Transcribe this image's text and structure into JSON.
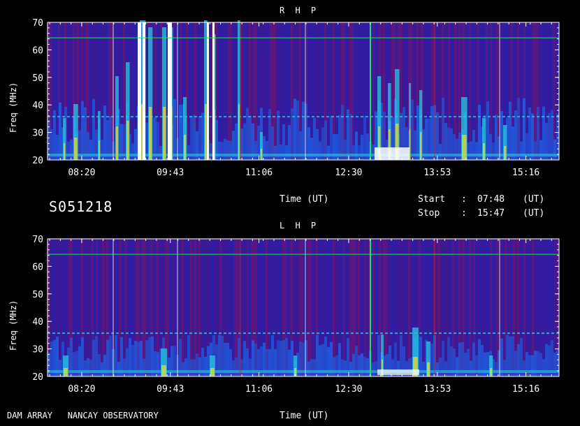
{
  "chart_data": [
    {
      "type": "heatmap",
      "title": "R H P",
      "ylabel": "Freq (MHz)",
      "xlabel": "Time (UT)",
      "ylim": [
        20,
        70
      ],
      "yticks": [
        "20",
        "30",
        "40",
        "50",
        "60",
        "70"
      ],
      "xticks": [
        "08:20",
        "09:43",
        "11:06",
        "12:30",
        "13:53",
        "15:16"
      ],
      "time_range": [
        "07:48",
        "15:47"
      ]
    },
    {
      "type": "heatmap",
      "title": "L H P",
      "ylabel": "Freq (MHz)",
      "xlabel": "Time (UT)",
      "ylim": [
        20,
        70
      ],
      "yticks": [
        "20",
        "30",
        "40",
        "50",
        "60",
        "70"
      ],
      "xticks": [
        "08:20",
        "09:43",
        "11:06",
        "12:30",
        "13:53",
        "15:16"
      ],
      "time_range": [
        "07:48",
        "15:47"
      ]
    }
  ],
  "header": {
    "session": "S051218",
    "time_label": "Time (UT)",
    "start_label": "Start",
    "start_sep": ":",
    "start_value": "07:48",
    "start_unit": "(UT)",
    "stop_label": "Stop",
    "stop_sep": ":",
    "stop_value": "15:47",
    "stop_unit": "(UT)"
  },
  "footer": {
    "observatory": "DAM ARRAY   NANCAY OBSERVATORY",
    "time_label": "Time (UT)"
  },
  "colors": {
    "background": "#5a1880",
    "low": "#2a1fa8",
    "mid": "#1f5ce0",
    "high": "#28c8e0",
    "peak": "#f0e020",
    "max": "#ffffff",
    "grid": "#ffffff",
    "marker_line": "#20e060",
    "red_line": "#d02020"
  }
}
